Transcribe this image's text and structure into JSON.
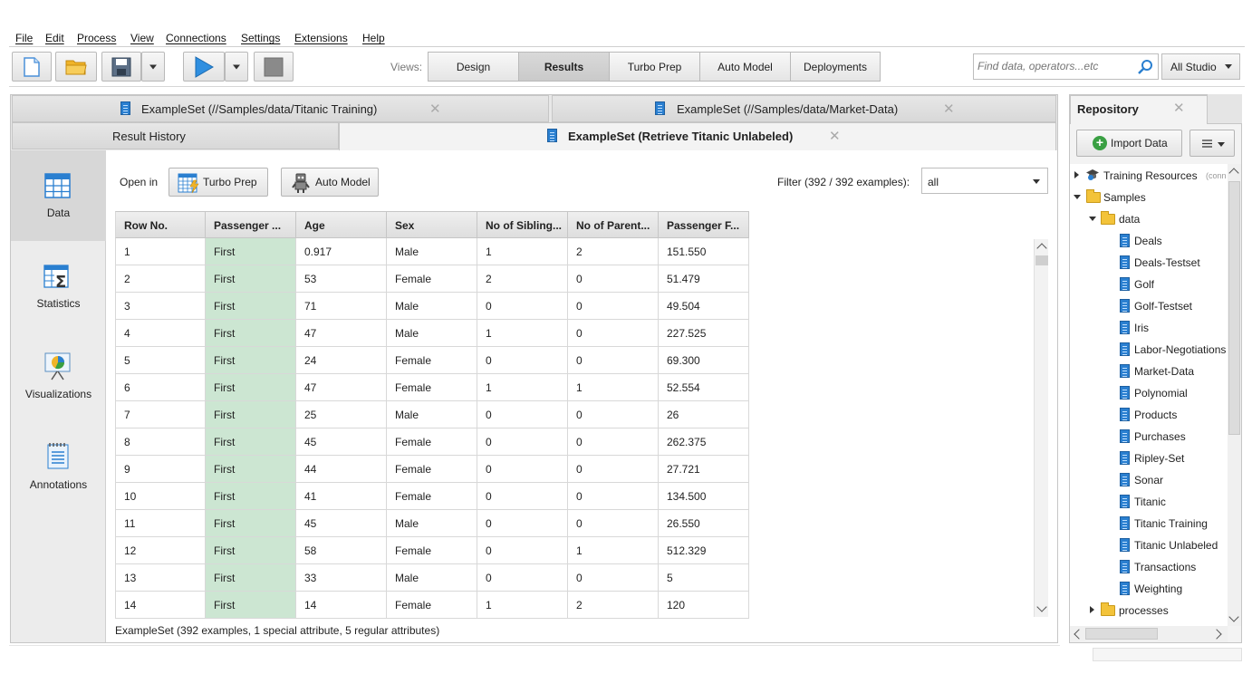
{
  "menu": [
    "File",
    "Edit",
    "Process",
    "View",
    "Connections",
    "Settings",
    "Extensions",
    "Help"
  ],
  "toolbar": {
    "views_label": "Views:",
    "views": [
      "Design",
      "Results",
      "Turbo Prep",
      "Auto Model",
      "Deployments"
    ],
    "active_view": "Results",
    "search_placeholder": "Find data, operators...etc",
    "scope": "All Studio"
  },
  "result_tabs": {
    "row1": [
      "ExampleSet (//Samples/data/Titanic Training)",
      "ExampleSet (//Samples/data/Market-Data)"
    ],
    "history": "Result History",
    "active": "ExampleSet (Retrieve Titanic Unlabeled)"
  },
  "sidebar": [
    {
      "label": "Data",
      "icon": "data-table-icon"
    },
    {
      "label": "Statistics",
      "icon": "statistics-icon"
    },
    {
      "label": "Visualizations",
      "icon": "visualizations-icon"
    },
    {
      "label": "Annotations",
      "icon": "annotations-icon"
    }
  ],
  "open_in": {
    "label": "Open in",
    "turbo_prep": "Turbo Prep",
    "auto_model": "Auto Model"
  },
  "filter": {
    "label": "Filter (392 / 392 examples):",
    "value": "all"
  },
  "table": {
    "columns": [
      "Row No.",
      "Passenger ...",
      "Age",
      "Sex",
      "No of Sibling...",
      "No of Parent...",
      "Passenger F..."
    ],
    "rows": [
      [
        "1",
        "First",
        "0.917",
        "Male",
        "1",
        "2",
        "151.550"
      ],
      [
        "2",
        "First",
        "53",
        "Female",
        "2",
        "0",
        "51.479"
      ],
      [
        "3",
        "First",
        "71",
        "Male",
        "0",
        "0",
        "49.504"
      ],
      [
        "4",
        "First",
        "47",
        "Male",
        "1",
        "0",
        "227.525"
      ],
      [
        "5",
        "First",
        "24",
        "Female",
        "0",
        "0",
        "69.300"
      ],
      [
        "6",
        "First",
        "47",
        "Female",
        "1",
        "1",
        "52.554"
      ],
      [
        "7",
        "First",
        "25",
        "Male",
        "0",
        "0",
        "26"
      ],
      [
        "8",
        "First",
        "45",
        "Female",
        "0",
        "0",
        "262.375"
      ],
      [
        "9",
        "First",
        "44",
        "Female",
        "0",
        "0",
        "27.721"
      ],
      [
        "10",
        "First",
        "41",
        "Female",
        "0",
        "0",
        "134.500"
      ],
      [
        "11",
        "First",
        "45",
        "Male",
        "0",
        "0",
        "26.550"
      ],
      [
        "12",
        "First",
        "58",
        "Female",
        "0",
        "1",
        "512.329"
      ],
      [
        "13",
        "First",
        "33",
        "Male",
        "0",
        "0",
        "5"
      ],
      [
        "14",
        "First",
        "14",
        "Female",
        "1",
        "2",
        "120"
      ]
    ]
  },
  "status": "ExampleSet (392 examples, 1 special attribute, 5 regular attributes)",
  "repository": {
    "title": "Repository",
    "import_label": "Import Data",
    "tree": {
      "training_resources": "Training Resources",
      "training_resources_suffix": "(conn",
      "samples": "Samples",
      "data": "data",
      "items": [
        "Deals",
        "Deals-Testset",
        "Golf",
        "Golf-Testset",
        "Iris",
        "Labor-Negotiations",
        "Market-Data",
        "Polynomial",
        "Products",
        "Purchases",
        "Ripley-Set",
        "Sonar",
        "Titanic",
        "Titanic Training",
        "Titanic Unlabeled",
        "Transactions",
        "Weighting"
      ],
      "processes": "processes"
    }
  },
  "colors": {
    "special_column": "#cce6d2",
    "accent_blue": "#2a7fd0"
  }
}
